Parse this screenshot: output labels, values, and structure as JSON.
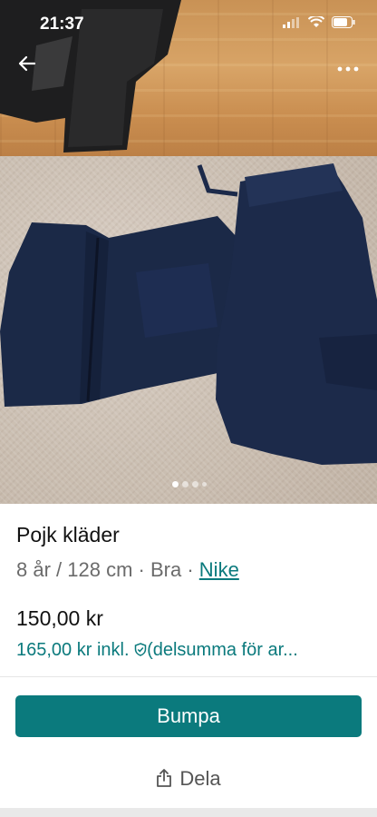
{
  "status_bar": {
    "time": "21:37"
  },
  "nav": {
    "back_icon": "arrow-left-icon",
    "more_icon": "more-horizontal-icon"
  },
  "gallery": {
    "image_count": 4,
    "active_index": 0
  },
  "item": {
    "title": "Pojk kläder",
    "size": "8 år / 128 cm",
    "separator": "·",
    "condition": "Bra",
    "brand": "Nike"
  },
  "pricing": {
    "price": "150,00 kr",
    "price_incl": "165,00 kr inkl.",
    "protection_note": "(delsumma för ar..."
  },
  "actions": {
    "bump_label": "Bumpa",
    "share_label": "Dela"
  },
  "colors": {
    "accent": "#0b7a7d"
  }
}
